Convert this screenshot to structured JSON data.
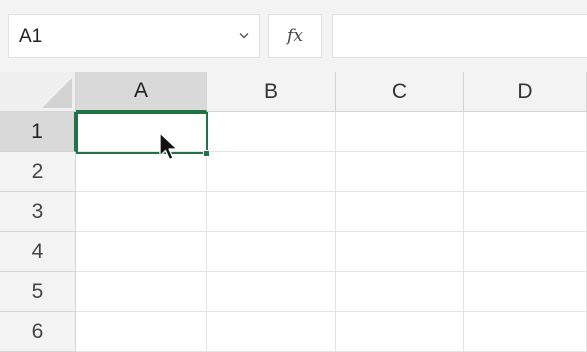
{
  "name_box": {
    "value": "A1"
  },
  "formula_bar": {
    "fx_label": "fx",
    "value": ""
  },
  "columns": [
    "A",
    "B",
    "C",
    "D"
  ],
  "rows": [
    "1",
    "2",
    "3",
    "4",
    "5",
    "6"
  ],
  "selected_cell": "A1",
  "colors": {
    "selection_accent": "#217346",
    "header_background": "#f3f3f3",
    "selected_header_background": "#d9d9d9",
    "gridline": "#e3e3e3"
  },
  "icons": {
    "name_box_dropdown": "chevron-down-icon",
    "formula": "fx-icon",
    "pointer": "mouse-pointer-icon"
  }
}
